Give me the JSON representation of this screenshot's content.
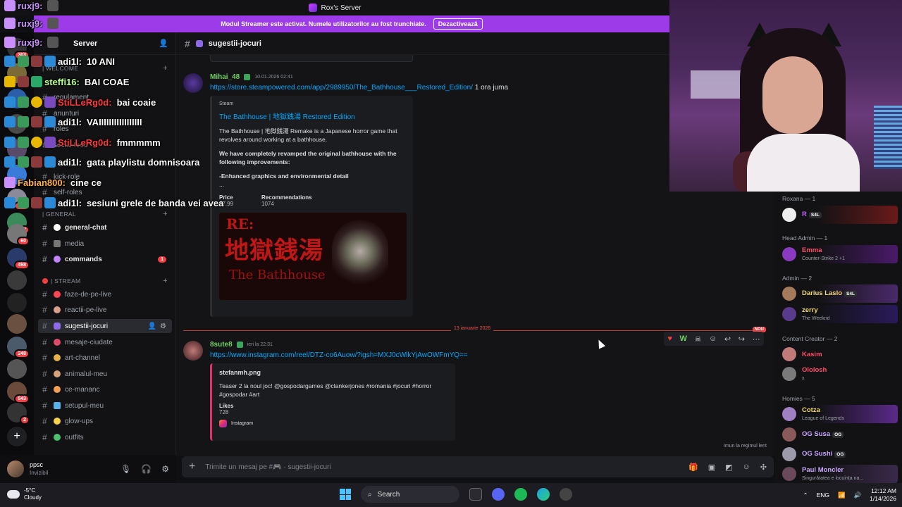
{
  "window": {
    "title": "Rox's Server"
  },
  "banner": {
    "text": "Modul Streamer este activat. Numele utilizatorilor au fost trunchiate.",
    "button": "Dezactivează"
  },
  "server": {
    "name": "Server"
  },
  "rail_badges": [
    "303",
    "60",
    "498",
    "248",
    "543",
    "2",
    "314",
    "2"
  ],
  "sidebar": {
    "categories": [
      {
        "label": "| WELCOME"
      },
      {
        "label": "| GENERAL"
      },
      {
        "label": "| STREAM"
      }
    ],
    "channels": [
      {
        "label": "regulament"
      },
      {
        "label": "anunturi"
      },
      {
        "label": "roles"
      },
      {
        "label": "social-feed"
      },
      {
        "label": "kick-role"
      },
      {
        "label": "self-roles"
      },
      {
        "label": "general-chat"
      },
      {
        "label": "media"
      },
      {
        "label": "commands",
        "badge": "1"
      },
      {
        "label": "faze-de-pe-live"
      },
      {
        "label": "reactii-pe-live"
      },
      {
        "label": "sugestii-jocuri"
      },
      {
        "label": "mesaje-ciudate"
      },
      {
        "label": "art-channel"
      },
      {
        "label": "animalul-meu"
      },
      {
        "label": "ce-mananc"
      },
      {
        "label": "setupul-meu"
      },
      {
        "label": "glow-ups"
      },
      {
        "label": "outfits"
      }
    ]
  },
  "user": {
    "name": "ppsc",
    "status": "Invizibil"
  },
  "channel": {
    "name": "sugestii-jocuri"
  },
  "messages": [
    {
      "author": "Mihai_48",
      "time": "10.01.2026 02:41",
      "link": "https://store.steampowered.com/app/2989950/The_Bathhouse___Restored_Edition/",
      "after": "1 ora juma",
      "embed": {
        "provider": "Steam",
        "title": "The Bathhouse | 地獄銭湯 Restored Edition",
        "desc1": "The Bathhouse | 地獄銭湯 Remake is a Japanese horror game that revolves around working at a bathhouse.",
        "desc2": "We have completely revamped the original bathhouse with the following improvements:",
        "desc3": "-Enhanced graphics and environmental detail",
        "desc4": "...",
        "f1name": "Price",
        "f1val": "$7.99",
        "f2name": "Recommendations",
        "f2val": "1074",
        "img_re": "RE:",
        "img_jp": "地獄銭湯",
        "img_en": "The Bathhouse"
      }
    },
    {
      "author": "8sute8",
      "time": "ieri la 22:31",
      "link": "https://www.instagram.com/reel/DTZ-co6Auow/?igsh=MXJ0cWlkYjAwOWFmYQ==",
      "embed": {
        "title": "stefanmh.png",
        "desc": "Teaser 2 la noul joc! @gospodargames @clankerjones #romania #jocuri #horror #gospodar #art",
        "fname": "Likes",
        "fval": "728",
        "footer": "Instagram"
      }
    }
  ],
  "divider": {
    "date": "13 ianuarie 2026",
    "new": "NOU"
  },
  "slowmode": "Imun la regimul lent",
  "composer": {
    "placeholder": "Trimite un mesaj pe #🎮 · sugestii-jocuri"
  },
  "members": {
    "groups": [
      {
        "label": "Roxana — 1"
      },
      {
        "label": "Head Admin — 1"
      },
      {
        "label": "Admin — 2"
      },
      {
        "label": "Content Creator — 2"
      },
      {
        "label": "Homies — 5"
      }
    ],
    "list": [
      {
        "name": "R",
        "tag": "S4L",
        "color": "#c15cff"
      },
      {
        "name": "Emma",
        "status": "Counter-Strike 2 +1",
        "color": "#ff4d6a"
      },
      {
        "name": "Darius Laslo",
        "tag": "S4L",
        "color": "#f2d96b"
      },
      {
        "name": "zerry",
        "status": "The Weeknd",
        "color": "#f2d96b"
      },
      {
        "name": "Kasim",
        "color": "#ff4d6a"
      },
      {
        "name": "Ololosh",
        "status": "x",
        "color": "#ff4d6a"
      },
      {
        "name": "Cotza",
        "status": "League of Legends",
        "color": "#f2d96b"
      },
      {
        "name": "OG Susa",
        "tag": "OG",
        "color": "#c9a7ff"
      },
      {
        "name": "OG Sushi",
        "tag": "OG",
        "color": "#c9a7ff"
      },
      {
        "name": "Paul Moncler",
        "status": "Singurătatea e locuința na...",
        "color": "#c9a7ff"
      }
    ]
  },
  "chat": [
    {
      "user": "ruxj9:",
      "text": "",
      "color": "#c98fff"
    },
    {
      "user": "ruxj9:",
      "text": "",
      "color": "#c98fff"
    },
    {
      "user": "ruxj9:",
      "text": "",
      "color": "#c98fff"
    },
    {
      "user": "adi1l:",
      "text": "10 ANI",
      "color": "#ffffff"
    },
    {
      "user": "steffi16:",
      "text": "BAI COAE",
      "color": "#b7ff8a"
    },
    {
      "user": "StiLLeRg0d:",
      "text": "bai coaie",
      "color": "#ff3b3b"
    },
    {
      "user": "adi1l:",
      "text": "VAIIIIIIIIIIIIIIIII",
      "color": "#ffffff"
    },
    {
      "user": "StiLLeRg0d:",
      "text": "fmmmmm",
      "color": "#ff3b3b"
    },
    {
      "user": "adi1l:",
      "text": "gata playlistu domnisoara",
      "color": "#ffffff"
    },
    {
      "user": "Fabian800:",
      "text": "cine ce",
      "color": "#ffb347"
    },
    {
      "user": "adi1l:",
      "text": "sesiuni grele de banda vei avea",
      "color": "#ffffff"
    }
  ],
  "taskbar": {
    "temp": "-5°C",
    "weather": "Cloudy",
    "search": "Search",
    "lang": "ENG",
    "time": "12:12 AM",
    "date": "1/14/2026"
  }
}
